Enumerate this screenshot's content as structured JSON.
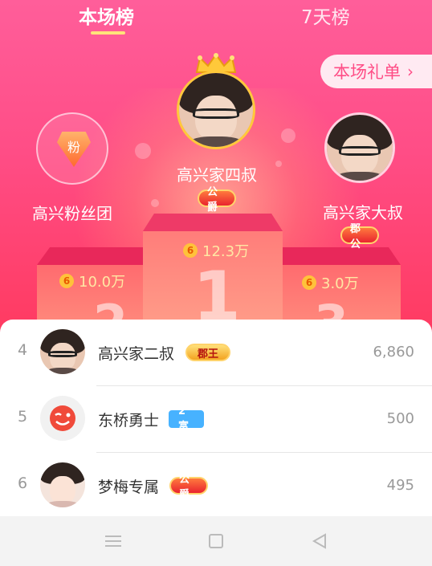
{
  "tabs": [
    {
      "label": "本场榜",
      "active": true
    },
    {
      "label": "7天榜",
      "active": false
    }
  ],
  "gift_list_button": {
    "label": "本场礼单",
    "chevron": "›"
  },
  "podium": {
    "first": {
      "name": "高兴家四叔",
      "badge": "公爵",
      "value": "12.3万",
      "rank_numeral": "1"
    },
    "second": {
      "name": "高兴粉丝团",
      "icon_char": "粉",
      "value": "10.0万",
      "rank_numeral": "2"
    },
    "third": {
      "name": "高兴家大叔",
      "badge": "郡公",
      "value": "3.0万",
      "rank_numeral": "3"
    }
  },
  "coin_symbol": "6",
  "ranking_list": [
    {
      "rank": "4",
      "name": "高兴家二叔",
      "badge": "郡王",
      "score": "6,860"
    },
    {
      "rank": "5",
      "name": "东桥勇士",
      "badge": "2 富",
      "score": "500"
    },
    {
      "rank": "6",
      "name": "梦梅专属",
      "badge": "公爵",
      "score": "495"
    }
  ],
  "nav_icons": [
    "menu-icon",
    "home-square-icon",
    "back-triangle-icon"
  ],
  "colors": {
    "accent": "#ff4d86",
    "gold": "#ffe37a",
    "badge_blue": "#47b2ff"
  }
}
